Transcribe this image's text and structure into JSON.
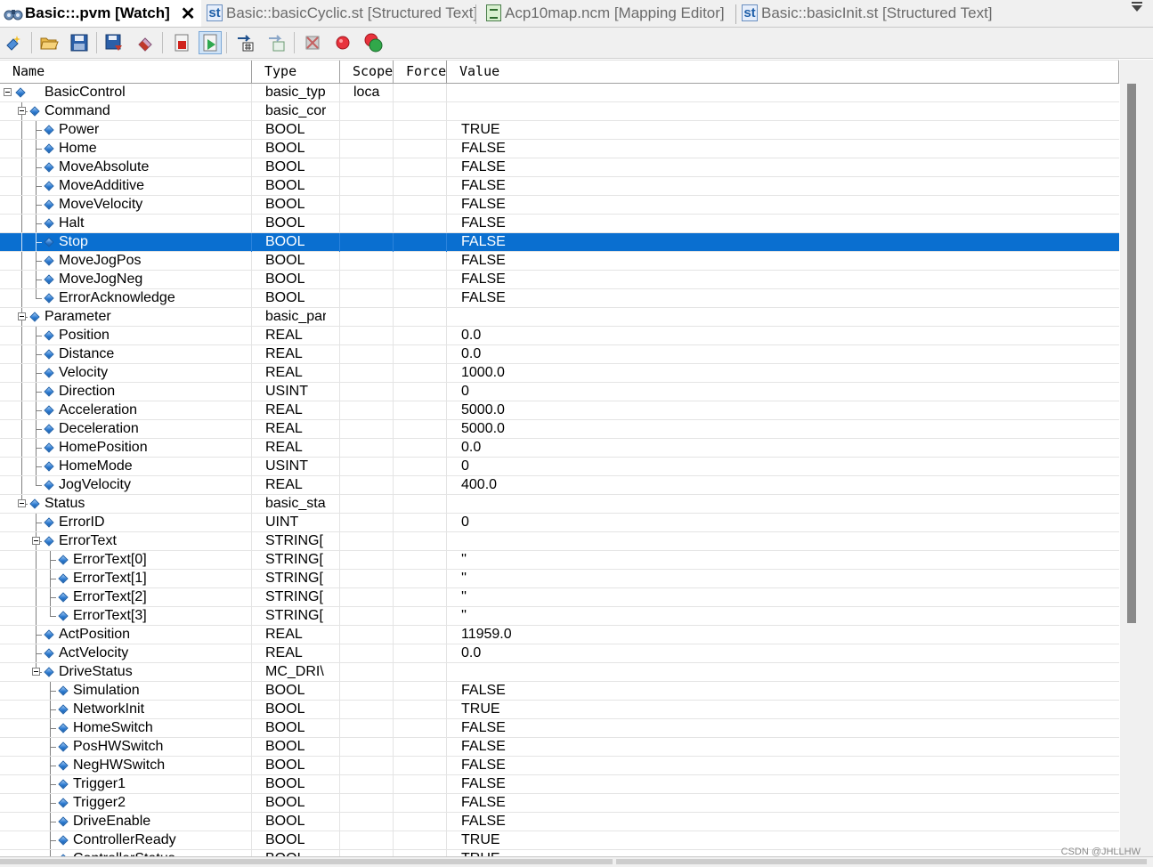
{
  "tabs": [
    {
      "label": "Basic::.pvm [Watch]",
      "icon": "watch-icon",
      "active": true
    },
    {
      "label": "Basic::basicCyclic.st [Structured Text]",
      "icon": "st-file-icon",
      "active": false
    },
    {
      "label": "Acp10map.ncm [Mapping Editor]",
      "icon": "mapping-file-icon",
      "active": false
    },
    {
      "label": "Basic::basicInit.st [Structured Text]",
      "icon": "st-file-icon",
      "active": false
    }
  ],
  "st_icon_text": "st",
  "close_glyph": "✕",
  "toolbar": [
    {
      "name": "insert-variable-icon"
    },
    {
      "name": "open-icon"
    },
    {
      "name": "save-icon"
    },
    {
      "name": "save-as-icon"
    },
    {
      "name": "erase-icon"
    },
    {
      "name": "stop-monitor-icon"
    },
    {
      "name": "run-monitor-icon",
      "pressed": true
    },
    {
      "name": "refresh-icon"
    },
    {
      "name": "copy-values-icon"
    },
    {
      "name": "force-off-icon"
    },
    {
      "name": "breakpoint-icon"
    },
    {
      "name": "multi-breakpoint-icon"
    }
  ],
  "columns": {
    "name": "Name",
    "type": "Type",
    "scope": "Scope",
    "force": "Force",
    "value": "Value"
  },
  "rows": [
    {
      "name": "BasicControl",
      "type": "basic_typ",
      "scope": "loca",
      "value": "",
      "level": 0,
      "expanded": true
    },
    {
      "name": "Command",
      "type": "basic_cor",
      "scope": "",
      "value": "",
      "level": 1,
      "expanded": true
    },
    {
      "name": "Power",
      "type": "BOOL",
      "scope": "",
      "value": "TRUE",
      "level": 2
    },
    {
      "name": "Home",
      "type": "BOOL",
      "scope": "",
      "value": "FALSE",
      "level": 2
    },
    {
      "name": "MoveAbsolute",
      "type": "BOOL",
      "scope": "",
      "value": "FALSE",
      "level": 2
    },
    {
      "name": "MoveAdditive",
      "type": "BOOL",
      "scope": "",
      "value": "FALSE",
      "level": 2
    },
    {
      "name": "MoveVelocity",
      "type": "BOOL",
      "scope": "",
      "value": "FALSE",
      "level": 2
    },
    {
      "name": "Halt",
      "type": "BOOL",
      "scope": "",
      "value": "FALSE",
      "level": 2
    },
    {
      "name": "Stop",
      "type": "BOOL",
      "scope": "",
      "value": "FALSE",
      "level": 2,
      "selected": true
    },
    {
      "name": "MoveJogPos",
      "type": "BOOL",
      "scope": "",
      "value": "FALSE",
      "level": 2
    },
    {
      "name": "MoveJogNeg",
      "type": "BOOL",
      "scope": "",
      "value": "FALSE",
      "level": 2
    },
    {
      "name": "ErrorAcknowledge",
      "type": "BOOL",
      "scope": "",
      "value": "FALSE",
      "level": 2
    },
    {
      "name": "Parameter",
      "type": "basic_par",
      "scope": "",
      "value": "",
      "level": 1,
      "expanded": true
    },
    {
      "name": "Position",
      "type": "REAL",
      "scope": "",
      "value": "0.0",
      "level": 2
    },
    {
      "name": "Distance",
      "type": "REAL",
      "scope": "",
      "value": "0.0",
      "level": 2
    },
    {
      "name": "Velocity",
      "type": "REAL",
      "scope": "",
      "value": "1000.0",
      "level": 2
    },
    {
      "name": "Direction",
      "type": "USINT",
      "scope": "",
      "value": "0",
      "level": 2
    },
    {
      "name": "Acceleration",
      "type": "REAL",
      "scope": "",
      "value": "5000.0",
      "level": 2
    },
    {
      "name": "Deceleration",
      "type": "REAL",
      "scope": "",
      "value": "5000.0",
      "level": 2
    },
    {
      "name": "HomePosition",
      "type": "REAL",
      "scope": "",
      "value": "0.0",
      "level": 2
    },
    {
      "name": "HomeMode",
      "type": "USINT",
      "scope": "",
      "value": "0",
      "level": 2
    },
    {
      "name": "JogVelocity",
      "type": "REAL",
      "scope": "",
      "value": "400.0",
      "level": 2
    },
    {
      "name": "Status",
      "type": "basic_sta",
      "scope": "",
      "value": "",
      "level": 1,
      "expanded": true
    },
    {
      "name": "ErrorID",
      "type": "UINT",
      "scope": "",
      "value": "0",
      "level": 2
    },
    {
      "name": "ErrorText",
      "type": "STRING[",
      "scope": "",
      "value": "",
      "level": 2,
      "expanded": true
    },
    {
      "name": "ErrorText[0]",
      "type": "STRING[",
      "scope": "",
      "value": "''",
      "level": 3
    },
    {
      "name": "ErrorText[1]",
      "type": "STRING[",
      "scope": "",
      "value": "''",
      "level": 3
    },
    {
      "name": "ErrorText[2]",
      "type": "STRING[",
      "scope": "",
      "value": "''",
      "level": 3
    },
    {
      "name": "ErrorText[3]",
      "type": "STRING[",
      "scope": "",
      "value": "''",
      "level": 3
    },
    {
      "name": "ActPosition",
      "type": "REAL",
      "scope": "",
      "value": "11959.0",
      "level": 2
    },
    {
      "name": "ActVelocity",
      "type": "REAL",
      "scope": "",
      "value": "0.0",
      "level": 2
    },
    {
      "name": "DriveStatus",
      "type": "MC_DRI\\",
      "scope": "",
      "value": "",
      "level": 2,
      "expanded": true
    },
    {
      "name": "Simulation",
      "type": "BOOL",
      "scope": "",
      "value": "FALSE",
      "level": 3
    },
    {
      "name": "NetworkInit",
      "type": "BOOL",
      "scope": "",
      "value": "TRUE",
      "level": 3
    },
    {
      "name": "HomeSwitch",
      "type": "BOOL",
      "scope": "",
      "value": "FALSE",
      "level": 3
    },
    {
      "name": "PosHWSwitch",
      "type": "BOOL",
      "scope": "",
      "value": "FALSE",
      "level": 3
    },
    {
      "name": "NegHWSwitch",
      "type": "BOOL",
      "scope": "",
      "value": "FALSE",
      "level": 3
    },
    {
      "name": "Trigger1",
      "type": "BOOL",
      "scope": "",
      "value": "FALSE",
      "level": 3
    },
    {
      "name": "Trigger2",
      "type": "BOOL",
      "scope": "",
      "value": "FALSE",
      "level": 3
    },
    {
      "name": "DriveEnable",
      "type": "BOOL",
      "scope": "",
      "value": "FALSE",
      "level": 3
    },
    {
      "name": "ControllerReady",
      "type": "BOOL",
      "scope": "",
      "value": "TRUE",
      "level": 3
    },
    {
      "name": "ControllerStatus",
      "type": "BOOL",
      "scope": "",
      "value": "TRUE",
      "level": 3
    }
  ],
  "watermark": "CSDN @JHLLHW",
  "colors": {
    "selection": "#0a6fd0",
    "selection_text": "#ffffff",
    "tree_icon": "#2a79d0"
  }
}
